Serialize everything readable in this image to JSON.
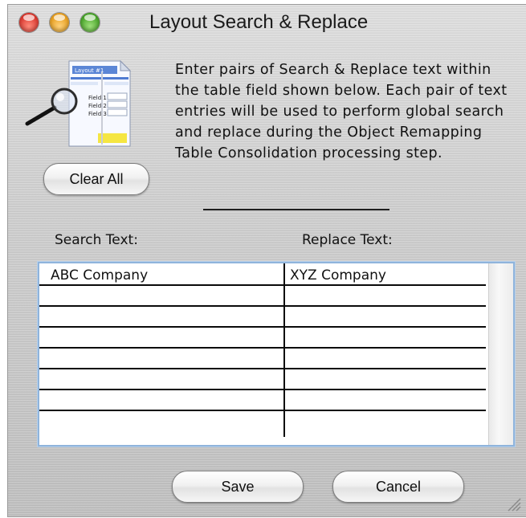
{
  "window": {
    "title": "Layout Search & Replace"
  },
  "icon": {
    "name": "layout-document-magnifier-icon",
    "labels": [
      "Layout #1",
      "Field 1",
      "Field 2",
      "Field 3"
    ]
  },
  "description": "Enter pairs of Search & Replace text within the table field shown below. Each pair of text entries will be used to perform global search and replace during the Object Remapping Table Consolidation processing step.",
  "buttons": {
    "clear_all": "Clear All",
    "save": "Save",
    "cancel": "Cancel"
  },
  "table": {
    "headers": {
      "search": "Search Text:",
      "replace": "Replace Text:"
    },
    "rows": [
      {
        "search": "ABC Company",
        "replace": "XYZ Company"
      },
      {
        "search": "",
        "replace": ""
      },
      {
        "search": "",
        "replace": ""
      },
      {
        "search": "",
        "replace": ""
      },
      {
        "search": "",
        "replace": ""
      },
      {
        "search": "",
        "replace": ""
      },
      {
        "search": "",
        "replace": ""
      },
      {
        "search": "",
        "replace": ""
      }
    ]
  },
  "colors": {
    "table_border": "#8fb4dc",
    "close": "#d8332a",
    "minimize": "#e69b18",
    "zoom": "#43a124"
  }
}
